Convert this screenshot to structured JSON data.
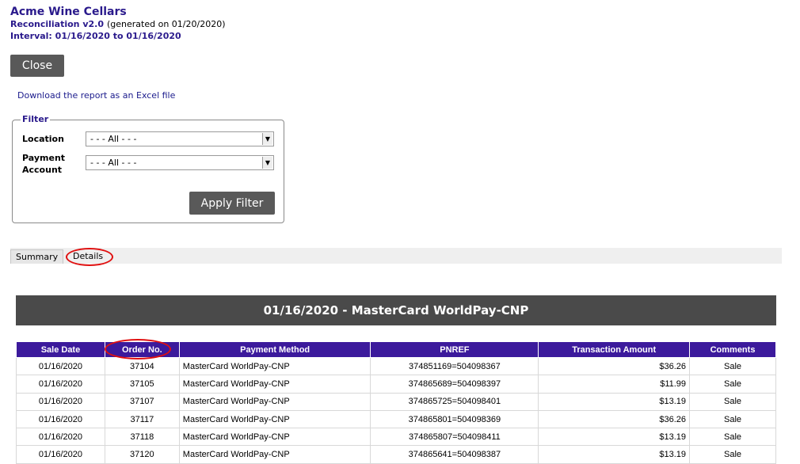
{
  "header": {
    "title": "Acme Wine Cellars",
    "report": "Reconciliation v2.0",
    "generated": "(generated on 01/20/2020)",
    "interval": "Interval: 01/16/2020 to 01/16/2020"
  },
  "close_label": "Close",
  "download_link": "Download the report as an Excel file",
  "filter": {
    "legend": "Filter",
    "location_label": "Location",
    "location_value": "- - - All - - -",
    "payment_label_1": "Payment",
    "payment_label_2": "Account",
    "payment_value": "- - - All - - -",
    "apply_label": "Apply Filter"
  },
  "tabs": {
    "summary": "Summary",
    "details": "Details",
    "active": "Details"
  },
  "banner": "01/16/2020 - MasterCard WorldPay-CNP",
  "table": {
    "headers": [
      "Sale Date",
      "Order No.",
      "Payment Method",
      "PNREF",
      "Transaction Amount",
      "Comments"
    ],
    "rows": [
      [
        "01/16/2020",
        "37104",
        "MasterCard WorldPay-CNP",
        "374851169=504098367",
        "$36.26",
        "Sale"
      ],
      [
        "01/16/2020",
        "37105",
        "MasterCard WorldPay-CNP",
        "374865689=504098397",
        "$11.99",
        "Sale"
      ],
      [
        "01/16/2020",
        "37107",
        "MasterCard WorldPay-CNP",
        "374865725=504098401",
        "$13.19",
        "Sale"
      ],
      [
        "01/16/2020",
        "37117",
        "MasterCard WorldPay-CNP",
        "374865801=504098369",
        "$36.26",
        "Sale"
      ],
      [
        "01/16/2020",
        "37118",
        "MasterCard WorldPay-CNP",
        "374865807=504098411",
        "$13.19",
        "Sale"
      ],
      [
        "01/16/2020",
        "37120",
        "MasterCard WorldPay-CNP",
        "374865641=504098387",
        "$13.19",
        "Sale"
      ]
    ]
  },
  "colors": {
    "header_text": "#2a1a8c",
    "table_header": "#3c1a9c",
    "banner": "#4a4a4a",
    "annotation": "#e01010"
  }
}
